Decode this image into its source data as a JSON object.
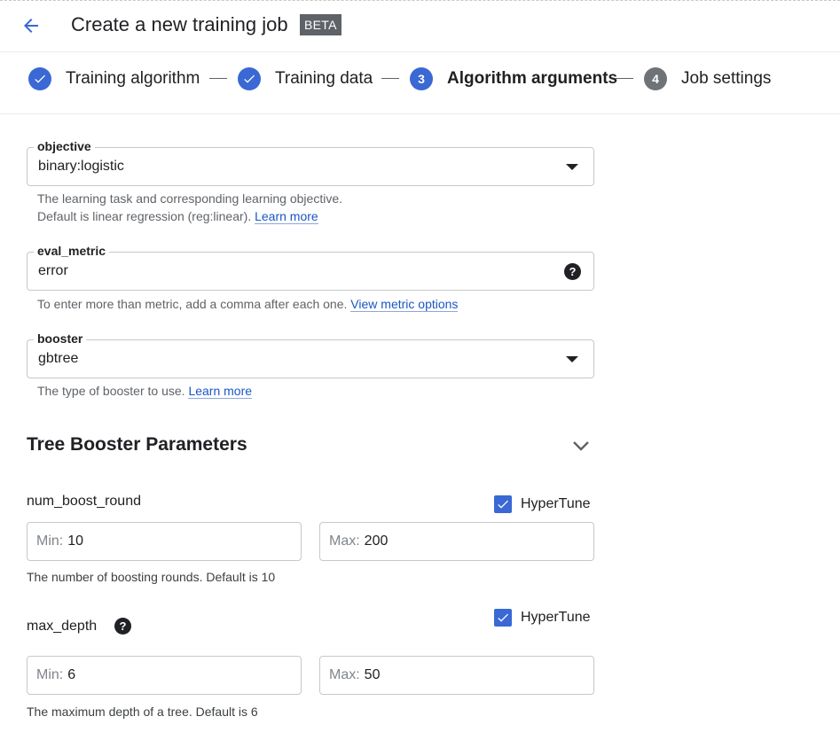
{
  "header": {
    "title": "Create a new training job",
    "badge": "BETA"
  },
  "stepper": {
    "steps": [
      {
        "number": "",
        "label": "Training algorithm",
        "state": "done"
      },
      {
        "number": "",
        "label": "Training data",
        "state": "done"
      },
      {
        "number": "3",
        "label": "Algorithm arguments",
        "state": "active"
      },
      {
        "number": "4",
        "label": "Job settings",
        "state": "todo"
      }
    ]
  },
  "fields": {
    "objective": {
      "label": "objective",
      "value": "binary:logistic",
      "hint_line1": "The learning task and corresponding learning objective.",
      "hint_line2": "Default is linear regression (reg:linear).",
      "link": "Learn more"
    },
    "eval_metric": {
      "label": "eval_metric",
      "value": "error",
      "help_icon": "?",
      "hint": "To enter more than metric, add a comma after each one.",
      "link": "View metric options"
    },
    "booster": {
      "label": "booster",
      "value": "gbtree",
      "hint": "The type of booster to use.",
      "link": "Learn more"
    }
  },
  "tree_booster": {
    "title": "Tree Booster Parameters",
    "num_boost_round": {
      "label": "num_boost_round",
      "hypertune_label": "HyperTune",
      "hypertune_checked": true,
      "min_prefix": "Min:",
      "min_value": "10",
      "max_prefix": "Max:",
      "max_value": "200",
      "hint": "The number of boosting rounds. Default is 10"
    },
    "max_depth": {
      "label": "max_depth",
      "help_icon": "?",
      "hypertune_label": "HyperTune",
      "hypertune_checked": true,
      "min_prefix": "Min:",
      "min_value": "6",
      "max_prefix": "Max:",
      "max_value": "50",
      "hint": "The maximum depth of a tree. Default is 6"
    }
  },
  "colors": {
    "accent": "#3a68d4",
    "link": "#1a56c4",
    "todo_step": "#6f7377"
  },
  "icons": {
    "back": "arrow-left-icon",
    "done_step": "check-icon",
    "dropdown": "caret-down-icon",
    "help": "help-circle-icon",
    "collapse": "chevron-down-icon"
  }
}
